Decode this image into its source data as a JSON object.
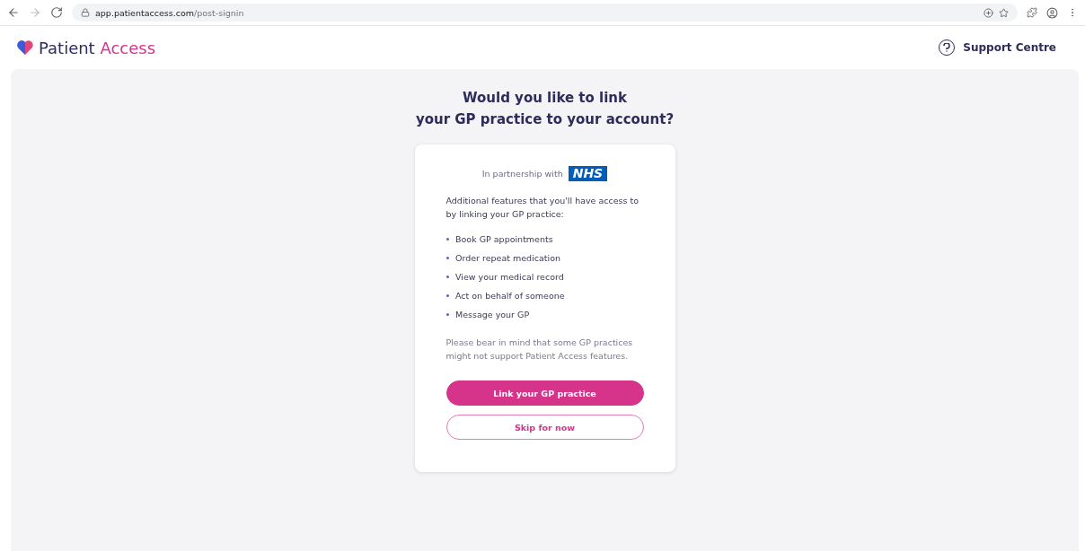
{
  "browser": {
    "url_domain": "app.patientaccess.com",
    "url_path": "/post-signin"
  },
  "header": {
    "brand_first": "Patient",
    "brand_second": "Access",
    "support": "Support Centre"
  },
  "title_lines": [
    "Would you like to link",
    "your GP practice to your account?"
  ],
  "card": {
    "partner_text": "In partnership with",
    "partner_logo": "NHS",
    "intro": "Additional features that you'll have access to by linking your GP practice:",
    "features": [
      "Book GP appointments",
      "Order repeat medication",
      "View your medical record",
      "Act on behalf of someone",
      "Message your GP"
    ],
    "note": "Please bear in mind that some GP practices might not support Patient Access features.",
    "buttons": [
      {
        "kind": "primary",
        "label": "Link your GP practice"
      },
      {
        "kind": "secondary",
        "label": "Skip for now"
      }
    ]
  }
}
